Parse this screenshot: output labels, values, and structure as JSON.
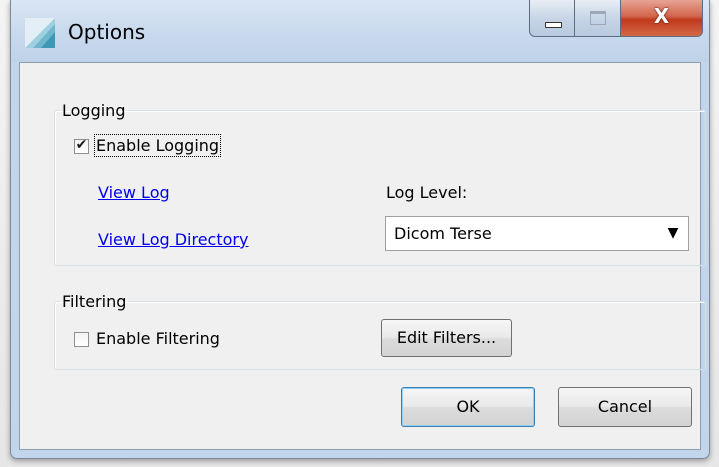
{
  "window": {
    "title": "Options",
    "icon": "app-icon",
    "caption_buttons": {
      "minimize": "minimize-icon",
      "maximize": "maximize-icon",
      "close_glyph": "X"
    }
  },
  "logging": {
    "legend": "Logging",
    "enable_label": "Enable Logging",
    "enable_checked": true,
    "view_log_link": "View Log",
    "view_log_directory_link": "View Log Directory",
    "log_level_label": "Log Level:",
    "log_level_value": "Dicom Terse"
  },
  "filtering": {
    "legend": "Filtering",
    "enable_label": "Enable Filtering",
    "enable_checked": false,
    "edit_filters_button": "Edit Filters..."
  },
  "footer": {
    "ok_button": "OK",
    "cancel_button": "Cancel"
  },
  "colors": {
    "link": "#0000ee",
    "close_button": "#c2391d",
    "titlebar": "#c9daee"
  }
}
